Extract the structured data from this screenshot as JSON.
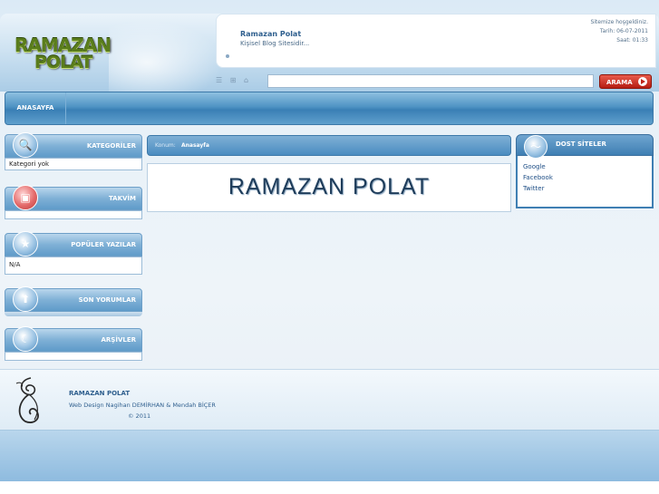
{
  "header": {
    "logo_line1": "RAMAZAN",
    "logo_line2": "POLAT",
    "site_name": "Ramazan Polat",
    "tagline": "Kişisel Blog Sitesidir...",
    "welcome": "Sitemize hoşgeldiniz.",
    "date": "Tarih: 06-07-2011",
    "time": "Saat: 01:33"
  },
  "search": {
    "value": "",
    "button_label": "ARAMA"
  },
  "toolbar_icons": [
    "list-icon",
    "rss-icon",
    "home-icon"
  ],
  "nav": {
    "items": [
      {
        "label": "ANASAYFA"
      }
    ]
  },
  "sidebar": {
    "categories": {
      "title": "KATEGORİLER",
      "body": "Kategori yok",
      "icon": "search-icon"
    },
    "calendar": {
      "title": "TAKVİM",
      "body": "",
      "icon": "calendar-icon"
    },
    "popular": {
      "title": "POPÜLER YAZILAR",
      "body": "N/A",
      "icon": "star-icon"
    },
    "comments": {
      "title": "SON YORUMLAR",
      "body": "",
      "icon": "user-icon"
    },
    "archive": {
      "title": "ARŞİVLER",
      "body": "",
      "icon": "moon-icon"
    }
  },
  "breadcrumb": {
    "prefix": "Konum:",
    "current": "Anasayfa"
  },
  "content": {
    "headline": "RAMAZAN POLAT"
  },
  "friends": {
    "title": "DOST SİTELER",
    "links": [
      "Google",
      "Facebook",
      "Twitter"
    ]
  },
  "footer": {
    "name": "RAMAZAN POLAT",
    "design": "Web Design Nagihan DEMİRHAN & Mendah BİÇER",
    "copyright": "© 2011"
  },
  "colors": {
    "accent": "#3f7fb3",
    "search_button": "#c0261a",
    "logo": "#5a7d1c"
  }
}
